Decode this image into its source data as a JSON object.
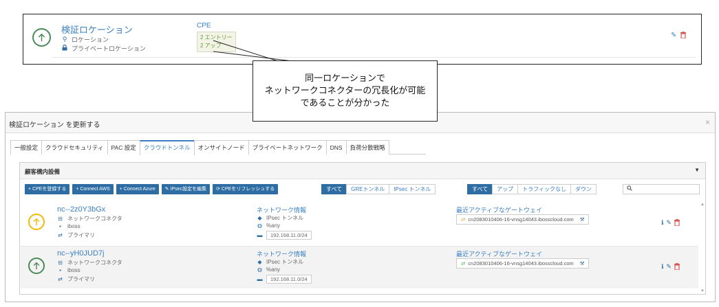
{
  "location_card": {
    "title": "検証ロケーション",
    "subtitle_location": "ロケーション",
    "subtitle_private": "プライベートロケーション",
    "cpe_label": "CPE",
    "cpe_entries": "2 エントリー",
    "cpe_up": "2 アップ",
    "status_color": "#4a8a57"
  },
  "callout": {
    "line1": "同一ロケーションで",
    "line2": "ネットワークコネクターの冗長化が可能",
    "line3": "であることが分かった"
  },
  "dialog": {
    "title": "検証ロケーション を更新する",
    "close": "×",
    "tabs": [
      {
        "label": "一般設定"
      },
      {
        "label": "クラウドセキュリティ"
      },
      {
        "label": "PAC 設定"
      },
      {
        "label": "クラウドトンネル"
      },
      {
        "label": "オンサイトノード"
      },
      {
        "label": "プライベートネットワーク"
      },
      {
        "label": "DNS"
      },
      {
        "label": "負荷分散戦略"
      }
    ],
    "active_tab": "クラウドトンネル",
    "panel": {
      "title": "顧客構内設備",
      "buttons": [
        "+ CPEを登録する",
        "+ Connect AWS",
        "+ Connect Azure",
        "✎ IPsec設定を編集",
        "⟳ CPEをリフレッシュする"
      ],
      "filter_type": [
        "すべて",
        "GREトンネル",
        "IPsec トンネル"
      ],
      "filter_status": [
        "すべて",
        "アップ",
        "トラフィックなし",
        "ダウン"
      ],
      "search_placeholder": "",
      "rows": [
        {
          "name": "nc--2z0Y3bGx",
          "type": "ネットワークコネクタ",
          "vendor": "iboss",
          "role": "プライマリ",
          "net_title": "ネットワーク情報",
          "tunnel": "IPsec トンネル",
          "any": "%any",
          "cidr": "192.168.11.0/24",
          "gw_title": "最近アクティブなゲートウェイ",
          "gateway": "cn2083010406-16-vnsg14043.ibosscloud.com",
          "status": "warning",
          "status_color": "#f5b800"
        },
        {
          "name": "nc--yH0JUD7j",
          "type": "ネットワークコネクタ",
          "vendor": "iboss",
          "role": "プライマリ",
          "net_title": "ネットワーク情報",
          "tunnel": "IPsec トンネル",
          "any": "%any",
          "cidr": "192.168.11.0/24",
          "gw_title": "最近アクティブなゲートウェイ",
          "gateway": "cn2083010406-16-vnsg14043.ibosscloud.com",
          "status": "up",
          "status_color": "#4a8a57"
        }
      ]
    }
  },
  "colors": {
    "accent": "#3a7fc4",
    "button": "#2e6da4",
    "delete": "#d9534f",
    "warning": "#f5b800",
    "up": "#4a8a57"
  }
}
